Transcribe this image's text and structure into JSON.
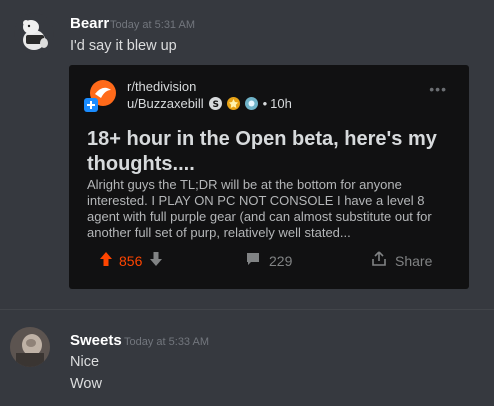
{
  "messages": [
    {
      "username": "Bearr",
      "timestamp": "Today at 5:31 AM",
      "lines": [
        "I'd say it blew up"
      ]
    },
    {
      "username": "Sweets",
      "timestamp": "Today at 5:33 AM",
      "lines": [
        "Nice",
        "Wow"
      ]
    }
  ],
  "embed": {
    "subreddit": "r/thedivision",
    "author": "u/Buzzaxebill",
    "age": "10h",
    "title": "18+ hour in the Open beta, here's my thoughts....",
    "body": "Alright guys the TL;DR will be at the bottom for anyone interested.  I PLAY ON PC NOT CONSOLE  I have a level 8 agent with full purple gear (and can almost substitute out for another full set of purp, relatively well stated...",
    "upvotes": "856",
    "comments": "229",
    "share_label": "Share",
    "upvote_color": "#ff4500"
  }
}
